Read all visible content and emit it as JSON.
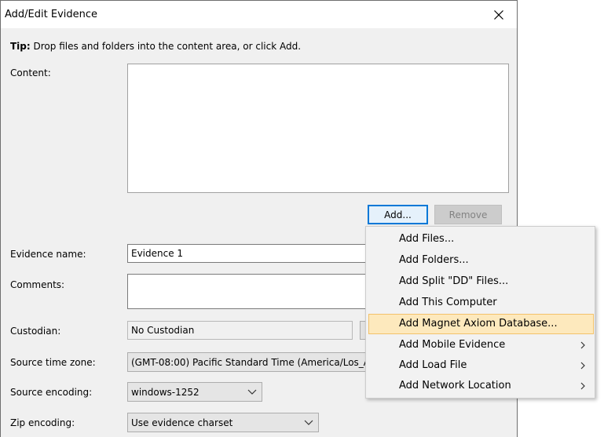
{
  "window": {
    "title": "Add/Edit Evidence"
  },
  "tip": {
    "bold": "Tip:",
    "text": "Drop files and folders into the content area, or click Add."
  },
  "labels": {
    "content": "Content:",
    "evidence_name": "Evidence name:",
    "comments": "Comments:",
    "custodian": "Custodian:",
    "source_time_zone": "Source time zone:",
    "source_encoding": "Source encoding:",
    "zip_encoding": "Zip encoding:"
  },
  "buttons": {
    "add": "Add...",
    "remove": "Remove"
  },
  "fields": {
    "evidence_name": "Evidence 1",
    "comments": "",
    "custodian": "No Custodian",
    "time_zone": "(GMT-08:00) Pacific Standard Time (America/Los_A",
    "source_encoding": "windows-1252",
    "zip_encoding": "Use evidence charset"
  },
  "menu": {
    "items": [
      {
        "label": "Add Files...",
        "submenu": false,
        "highlighted": false
      },
      {
        "label": "Add Folders...",
        "submenu": false,
        "highlighted": false
      },
      {
        "label": "Add Split \"DD\" Files...",
        "submenu": false,
        "highlighted": false
      },
      {
        "label": "Add This Computer",
        "submenu": false,
        "highlighted": false
      },
      {
        "label": "Add Magnet Axiom Database...",
        "submenu": false,
        "highlighted": true
      },
      {
        "label": "Add Mobile Evidence",
        "submenu": true,
        "highlighted": false
      },
      {
        "label": "Add Load File",
        "submenu": true,
        "highlighted": false
      },
      {
        "label": "Add Network Location",
        "submenu": true,
        "highlighted": false
      }
    ]
  },
  "icons": {
    "close": "close-icon",
    "dropdown": "chevron-down-icon",
    "submenu": "chevron-right-icon"
  },
  "colors": {
    "dialog_bg": "#f0f0f0",
    "focus_blue": "#0078d7",
    "menu_highlight": "#fde9bd"
  }
}
